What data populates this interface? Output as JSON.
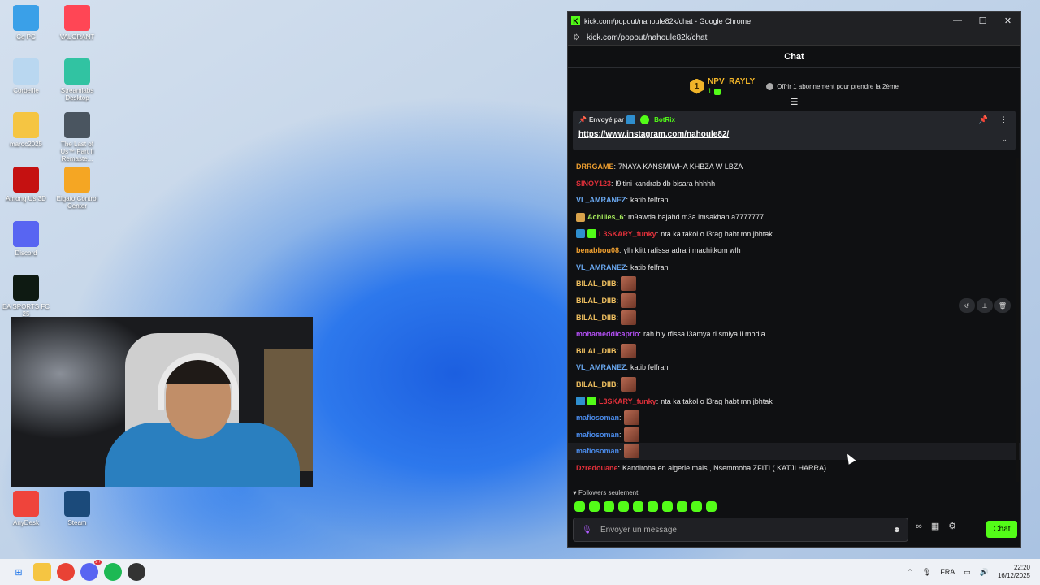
{
  "desktop": {
    "icons": [
      {
        "label": "Ce PC",
        "icon": "monitor-icon",
        "color": "#3aa0e8"
      },
      {
        "label": "VALORANT",
        "icon": "valorant-icon",
        "color": "#ff4655"
      },
      {
        "label": "Corbeille",
        "icon": "recycle-bin-icon",
        "color": "#b9d7f0"
      },
      {
        "label": "Streamlabs Desktop",
        "icon": "streamlabs-icon",
        "color": "#31c3a2"
      },
      {
        "label": "maroc2025",
        "icon": "folder-icon",
        "color": "#f5c542"
      },
      {
        "label": "The Last of Us™ Part II Remaste...",
        "icon": "tlou-icon",
        "color": "#4a5560"
      },
      {
        "label": "Among Us 3D",
        "icon": "among-us-icon",
        "color": "#c51111"
      },
      {
        "label": "Elgato Control Center",
        "icon": "elgato-icon",
        "color": "#f5a623"
      },
      {
        "label": "Discord",
        "icon": "discord-icon",
        "color": "#5865f2"
      },
      {
        "label": "EA SPORTS FC 25",
        "icon": "fc25-icon",
        "color": "#0e1a12"
      },
      {
        "label": "AnyDesk",
        "icon": "anydesk-icon",
        "color": "#ef443b"
      },
      {
        "label": "Steam",
        "icon": "steam-icon",
        "color": "#1b4a7a"
      }
    ]
  },
  "window": {
    "title": "kick.com/popout/nahoule82k/chat - Google Chrome",
    "url": "kick.com/popout/nahoule82k/chat",
    "minimize": "—",
    "maximize": "☐",
    "close": "✕"
  },
  "chat": {
    "header": "Chat",
    "gift": {
      "rank": "1",
      "name": "NPV_RAYLY",
      "count": "1",
      "offer": "Offrir 1 abonnement pour prendre la 2ème"
    },
    "pinned": {
      "sent_by": "Envoyé par",
      "bot": "BotRix",
      "link": "https://www.instagram.com/nahoule82/"
    },
    "messages": [
      {
        "user": "DRRGAME",
        "color": "#f0a030",
        "text": "7NAYA KANSMIWHA KHBZA W LBZA",
        "badges": []
      },
      {
        "user": "SINOY123",
        "color": "#e0303a",
        "text": "l9itini kandrab db bisara hhhhh",
        "badges": []
      },
      {
        "user": "VL_AMRANEZ",
        "color": "#6aa8f0",
        "text": "katib felfran",
        "badges": []
      },
      {
        "user": "Achilles_6",
        "color": "#a4e85a",
        "text": "m9awda bajahd m3a lmsakhan a7777777",
        "badges": [
          "og"
        ]
      },
      {
        "user": "L3SKARY_funky",
        "color": "#e0303a",
        "text": "nta ka takol o l3rag habt mn jbhtak",
        "badges": [
          "mod",
          "sub"
        ]
      },
      {
        "user": "benabbou08",
        "color": "#f0a030",
        "text": "ylh klitt rafissa adrari machitkom wlh",
        "badges": []
      },
      {
        "user": "VL_AMRANEZ",
        "color": "#6aa8f0",
        "text": "katib felfran",
        "badges": []
      },
      {
        "user": "BILAL_DIIB",
        "color": "#f0c060",
        "text": "",
        "emote": true,
        "badges": []
      },
      {
        "user": "BILAL_DIIB",
        "color": "#f0c060",
        "text": "",
        "emote": true,
        "badges": []
      },
      {
        "user": "BILAL_DIIB",
        "color": "#f0c060",
        "text": "",
        "emote": true,
        "badges": []
      },
      {
        "user": "mohameddicaprio",
        "color": "#b04ef0",
        "text": "rah hiy rfissa l3amya ri smiya li mbdla",
        "badges": []
      },
      {
        "user": "BILAL_DIIB",
        "color": "#f0c060",
        "text": "",
        "emote": true,
        "badges": []
      },
      {
        "user": "VL_AMRANEZ",
        "color": "#6aa8f0",
        "text": "katib felfran",
        "badges": []
      },
      {
        "user": "BILAL_DIIB",
        "color": "#f0c060",
        "text": "",
        "emote": true,
        "badges": []
      },
      {
        "user": "L3SKARY_funky",
        "color": "#e0303a",
        "text": "nta ka takol o l3rag habt mn jbhtak",
        "badges": [
          "mod",
          "sub"
        ]
      },
      {
        "user": "mafiosoman",
        "color": "#4a8ae8",
        "text": "",
        "emote": true,
        "badges": []
      },
      {
        "user": "mafiosoman",
        "color": "#4a8ae8",
        "text": "",
        "emote": true,
        "badges": []
      },
      {
        "user": "mafiosoman",
        "color": "#4a8ae8",
        "text": "",
        "emote": true,
        "badges": [],
        "highlight": true
      },
      {
        "user": "Dzredouane",
        "color": "#e0303a",
        "text": "Kandiroha en algerie mais , Nsemmoha ZFITI ( KATJI HARRA)",
        "badges": []
      }
    ],
    "followers_only": "Followers seulement",
    "input_placeholder": "Envoyer un message",
    "chat_button": "Chat",
    "accent": "#53fc18"
  },
  "taskbar": {
    "lang": "FRA",
    "time": "22:20",
    "date": "16/12/2025",
    "discord_badge": "9+"
  }
}
